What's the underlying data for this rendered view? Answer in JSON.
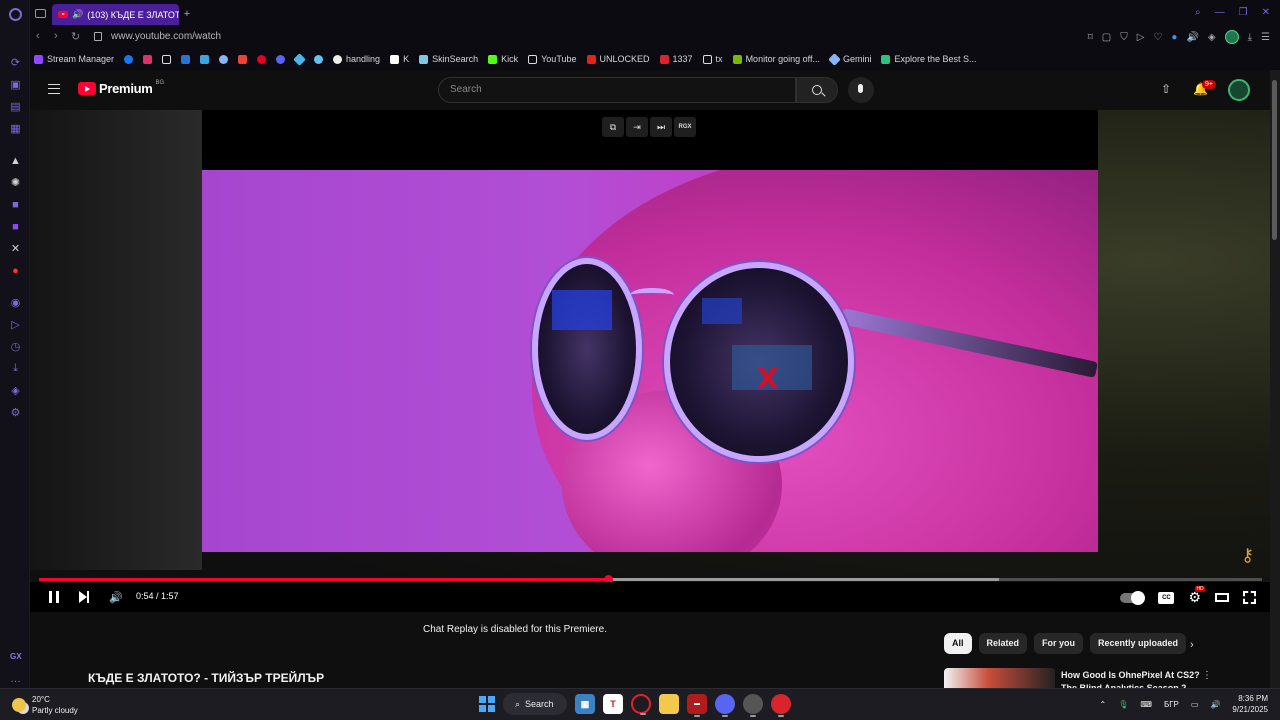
{
  "browser": {
    "tab_title": "(103) КЪДЕ Е ЗЛАТОТ",
    "url": "www.youtube.com/watch",
    "bookmarks": [
      "Stream Manager",
      "handling",
      "K",
      "SkinSearch",
      "Kick",
      "YouTube",
      "UNLOCKED",
      "1337",
      "tx",
      "Monitor going off...",
      "Gemini",
      "Explore the Best S..."
    ],
    "gx_label": "GX"
  },
  "youtube": {
    "logo_text": "Premium",
    "region": "BG",
    "search_placeholder": "Search",
    "notification_badge": "9+"
  },
  "player": {
    "overlay_label": "RGX",
    "time": "0:54 / 1:57",
    "progress_fraction": 0.465,
    "buffer_fraction": 0.785
  },
  "below_player": {
    "chat_replay_message": "Chat Replay is disabled for this Premiere.",
    "video_title": "КЪДЕ Е ЗЛАТОТО? - ТИЙЗЪР ТРЕЙЛЪР",
    "chips": [
      "All",
      "Related",
      "For you",
      "Recently uploaded"
    ],
    "recommended": {
      "title": "How Good Is OhnePixel At CS2? The Blind Analytics Season 2"
    }
  },
  "taskbar": {
    "temperature": "20°C",
    "condition": "Partly cloudy",
    "search_label": "Search",
    "language": "БГР",
    "time": "8:36 PM",
    "date": "9/21/2025"
  },
  "colors": {
    "accent": "#7b69d9",
    "youtube_red": "#ff0033",
    "tab_active": "#4b1e9a"
  }
}
